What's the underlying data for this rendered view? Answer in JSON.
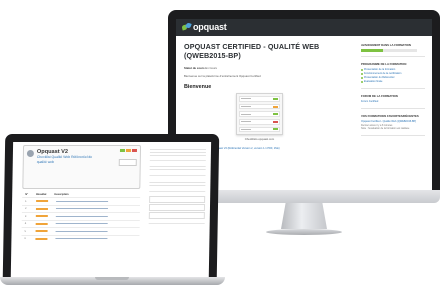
{
  "imac": {
    "brand": "opquast",
    "brand_tagline": "",
    "page_title": "OPQUAST CERTIFIED - QUALITÉ WEB (QWEB2015-BP)",
    "status_label": "Statut du cours",
    "status_value": "En Cours",
    "welcome_text": "Bienvenue sur la plateforme d'entraînement Opquast Certified",
    "section_heading": "Bienvenue",
    "app_caption": "Checklists.opquast.com",
    "footnote_prefix": "Télécharger l'",
    "footnote_link": "Évaluation Opquast V2 (Référentiel Version 2, version 1.1 PDF, 1Mo)",
    "sidebar": {
      "progress_heading": "AVANCEMENT DANS LA FORMATION",
      "progress": 0.4,
      "program_heading": "PROGRAMME DE LA FORMATION",
      "program_items": [
        "Présentation de la formation",
        "Fonctionnement de la certification",
        "Présentation du Référentiel",
        "Evaluation finale"
      ],
      "forum_heading": "FORUM DE LA FORMATION",
      "forum_link": "Forum Certified",
      "recent_heading": "VOS FORMATIONS FAVORITES/RÉCENTES",
      "recent_link": "Opquast Certified - Qualité Web (QWEB2015-BP)",
      "recent_lines": [
        "Dernier accès il y a 8 minutes",
        "Note : l'évaluation de la formation est réalisée"
      ]
    }
  },
  "laptop": {
    "card_title": "Opquast V2",
    "card_subtitle": "Checklist Qualité Web Référentiel de qualité web",
    "table_headers": [
      "N°",
      "Résultat",
      "Description"
    ],
    "table_rows": [
      "1",
      "2",
      "3",
      "4",
      "5",
      "6"
    ],
    "note": "",
    "heading": "",
    "paragraph": "",
    "paragraph2": "",
    "sidebar": {
      "block1_heading": "",
      "recent_heading": "",
      "recent_link": "",
      "form_heading": ""
    }
  }
}
